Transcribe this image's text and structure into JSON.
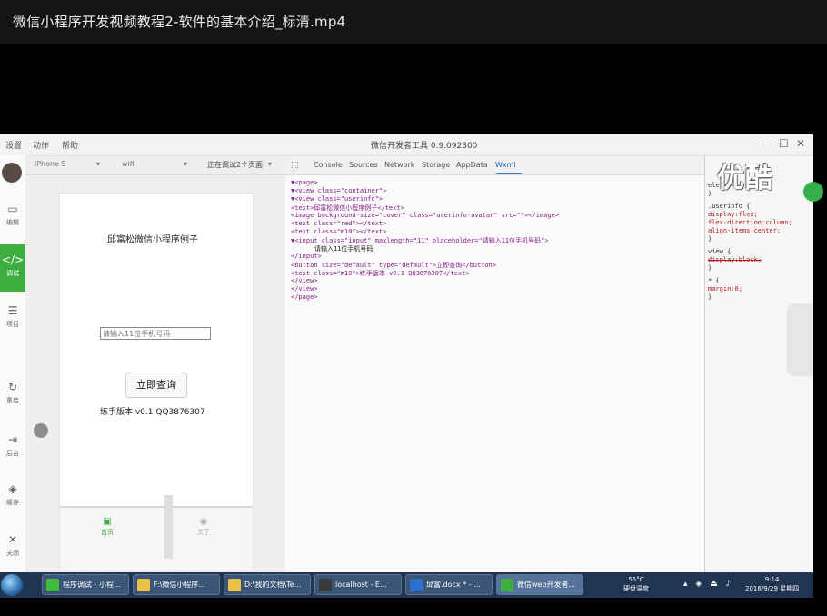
{
  "player": {
    "title": "微信小程序开发视频教程2-软件的基本介绍_标清.mp4"
  },
  "ide": {
    "title": "微信开发者工具 0.9.092300",
    "menu": [
      "设置",
      "动作",
      "帮助"
    ],
    "window_controls": [
      "—",
      "☐",
      "✕"
    ],
    "sidebar": [
      {
        "icon": "edit-icon",
        "glyph": "▭",
        "label": "编辑"
      },
      {
        "icon": "code-icon",
        "glyph": "</>",
        "label": "调试"
      },
      {
        "icon": "list-icon",
        "glyph": "☰",
        "label": "项目"
      },
      {
        "icon": "restart-icon",
        "glyph": "↻",
        "label": "重启"
      },
      {
        "icon": "back-icon",
        "glyph": "⇥",
        "label": "后台"
      },
      {
        "icon": "cache-icon",
        "glyph": "◈",
        "label": "缓存"
      },
      {
        "icon": "close-icon",
        "glyph": "✕",
        "label": "关闭"
      }
    ],
    "device_toolbar": {
      "device": "iPhone 5",
      "network": "wifi",
      "debug": "正在调试2个页面"
    },
    "simulator": {
      "app_title": "邱富松微信小程序例子",
      "input_placeholder": "请输入11位手机号码",
      "button_label": "立即查询",
      "version_text": "练手版本 v0.1 QQ3876307",
      "tabs": [
        {
          "label": "首页",
          "icon": "home-tab-icon",
          "glyph": "▣",
          "color": "#3eae41"
        },
        {
          "label": "关于",
          "icon": "about-tab-icon",
          "glyph": "◉",
          "color": "#aaaaaa"
        }
      ]
    },
    "devtools": {
      "tabs": [
        "Console",
        "Sources",
        "Network",
        "Storage",
        "AppData",
        "Wxml"
      ],
      "active_tab": "Wxml",
      "wxml_lines": [
        "▼<page>",
        "  ▼<view class=\"container\">",
        "    ▼<view class=\"userinfo\">",
        "        <text>邱富松微信小程序例子</text>",
        "      <image background-size=\"cover\" class=\"userinfo-avatar\" src=\"\"></image>",
        "        <text class=\"red\"></text>",
        "        <text class=\"m10\"></text>",
        "      ▼<input class=\"input\" maxlength=\"11\" placeholder=\"请输入11位手机号码\">",
        "请输入11位手机号码",
        "        </input>",
        "        <button size=\"default\" type=\"default\">立即查询</button>",
        "        <text class=\"m10\">练手版本 v0.1 QQ3876307</text>",
        "      </view>",
        "    </view>",
        "</page>"
      ],
      "styles": [
        {
          "text": "ele",
          "type": "sel"
        },
        {
          "text": "}",
          "type": "sel"
        },
        {
          "text": ".userinfo {",
          "type": "sel"
        },
        {
          "text": "  display:flex;",
          "type": "prop"
        },
        {
          "text": "  flex-direction:column;",
          "type": "prop"
        },
        {
          "text": "  align-items:center;",
          "type": "prop"
        },
        {
          "text": "}",
          "type": "sel"
        },
        {
          "text": "view {",
          "type": "sel"
        },
        {
          "text": "  display:block;",
          "type": "prop"
        },
        {
          "text": "}",
          "type": "sel"
        },
        {
          "text": "* {",
          "type": "sel"
        },
        {
          "text": "  margin:0;",
          "type": "prop"
        },
        {
          "text": "}",
          "type": "sel"
        }
      ]
    }
  },
  "watermark": "优酷",
  "taskbar": {
    "items": [
      {
        "label": "程序调试 - 小程...",
        "color": "#3dbb3d"
      },
      {
        "label": "F:\\微信小程序...",
        "color": "#e8c14a"
      },
      {
        "label": "D:\\我的文档\\Te...",
        "color": "#e8c14a"
      },
      {
        "label": "localhost - E...",
        "color": "#3a3a3a"
      },
      {
        "label": "邱富.docx * - ...",
        "color": "#2b6fd0"
      },
      {
        "label": "微信web开发者...",
        "color": "#3eae41"
      }
    ],
    "temp": "55°C",
    "temp_label": "硬盘温度",
    "time": "9:14",
    "date": "2016/9/29 星期四"
  }
}
